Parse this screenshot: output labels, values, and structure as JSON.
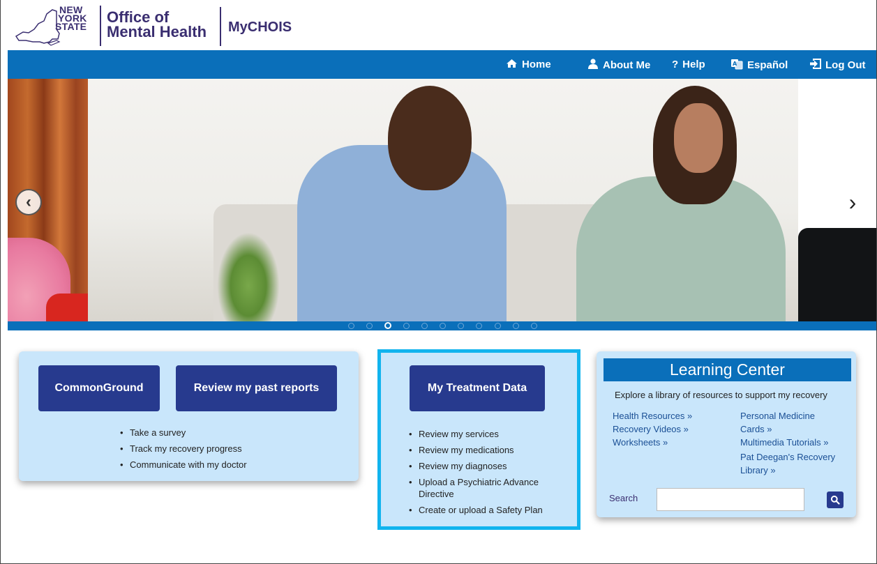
{
  "header": {
    "logo_words": [
      "NEW",
      "YORK",
      "STATE"
    ],
    "office_line1": "Office of",
    "office_line2": "Mental Health",
    "app_name": "MyCHOIS"
  },
  "nav": {
    "items": [
      {
        "label": "Home",
        "icon": "home-icon"
      },
      {
        "label": "About Me",
        "icon": "user-icon"
      },
      {
        "label": "Help",
        "icon": "question-icon"
      },
      {
        "label": "Español",
        "icon": "translate-icon"
      },
      {
        "label": "Log Out",
        "icon": "logout-icon"
      }
    ]
  },
  "carousel": {
    "prev_glyph": "‹",
    "next_glyph": "›",
    "slide_count": 11,
    "active_index": 2
  },
  "panel1": {
    "buttons": [
      "CommonGround",
      "Review my past reports"
    ],
    "bullets": [
      "Take a survey",
      "Track my recovery progress",
      "Communicate with my doctor"
    ]
  },
  "panel2": {
    "button": "My Treatment Data",
    "bullets": [
      "Review my services",
      "Review my medications",
      "Review my diagnoses",
      "Upload a Psychiatric Advance Directive",
      "Create or upload a Safety Plan"
    ]
  },
  "learning_center": {
    "title": "Learning Center",
    "description": "Explore a library of resources to support my recovery",
    "links_left": [
      "Health Resources »",
      "Recovery Videos »",
      "Worksheets »"
    ],
    "links_right": [
      "Personal Medicine Cards »",
      "Multimedia Tutorials »",
      "Pat Deegan's Recovery Library »"
    ],
    "search_label": "Search",
    "search_value": ""
  },
  "colors": {
    "nav_blue": "#0a6fba",
    "button_navy": "#273a8e",
    "panel_bg": "#c9e6fb",
    "highlight_border": "#11b4ee",
    "brand_purple": "#3a2e70"
  }
}
